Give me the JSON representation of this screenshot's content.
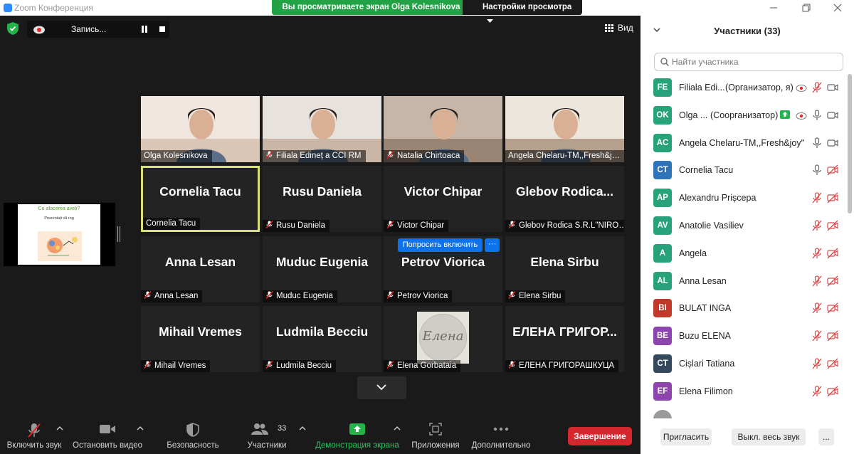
{
  "window": {
    "app_title": "Zoom Конференция"
  },
  "banner": {
    "text": "Вы просматриваете экран Olga Kolesnikova",
    "options_label": "Настройки просмотра"
  },
  "recording": {
    "label": "Запись..."
  },
  "view": {
    "label": "Вид"
  },
  "shared_screen": {
    "slide_title": "Ce afacerea aveți?",
    "slide_subtitle": "Prezentați vă rog"
  },
  "grid": {
    "ask_unmute_label": "Попросить включить",
    "more_label": "···",
    "tiles": [
      {
        "label": "Olga Kolesnikova",
        "muted": false,
        "video": true
      },
      {
        "label": "Filiala Edineț a CCI RM",
        "muted": true,
        "video": true
      },
      {
        "label": "Natalia Chirtoaca",
        "muted": true,
        "video": true
      },
      {
        "label": "Angela Chelaru-TM,,Fresh&j…",
        "muted": false,
        "video": true
      },
      {
        "name": "Cornelia Tacu",
        "label": "Cornelia Tacu",
        "muted": false,
        "active": true
      },
      {
        "name": "Rusu Daniela",
        "label": "Rusu Daniela",
        "muted": true
      },
      {
        "name": "Victor Chipar",
        "label": "Victor Chipar",
        "muted": true
      },
      {
        "name": "Glebov Rodica...",
        "label": "Glebov Rodica S.R.L\"NIRO…",
        "muted": true
      },
      {
        "name": "Anna Lesan",
        "label": "Anna Lesan",
        "muted": true
      },
      {
        "name": "Muduc Eugenia",
        "label": "Muduc Eugenia",
        "muted": true
      },
      {
        "name": "Petrov Viorica",
        "label": "Petrov Viorica",
        "muted": true
      },
      {
        "name": "Elena Sirbu",
        "label": "Elena Sirbu",
        "muted": true
      },
      {
        "name": "Mihail Vremes",
        "label": "Mihail Vremes",
        "muted": true
      },
      {
        "name": "Ludmila Becciu",
        "label": "Ludmila Becciu",
        "muted": true
      },
      {
        "label": "Elena Gorbataia",
        "muted": true,
        "avatar": true
      },
      {
        "name": "ЕЛЕНА ГРИГОР...",
        "label": "ЕЛЕНА ГРИГОРАШКУЦА",
        "muted": true
      }
    ]
  },
  "toolbar": {
    "unmute": "Включить звук",
    "video": "Остановить видео",
    "security": "Безопасность",
    "participants": "Участники",
    "participants_count": "33",
    "share": "Демонстрация экрана",
    "apps": "Приложения",
    "more": "Дополнительно",
    "end": "Завершение"
  },
  "panel": {
    "title": "Участники (33)",
    "search_placeholder": "Найти участника",
    "participants": [
      {
        "initials": "FE",
        "name": "Filiala Edi...",
        "role": "(Организатор, я)",
        "color": "#27a27a"
      },
      {
        "initials": "OK",
        "name": "Olga ...",
        "role": "(Соорганизатор)",
        "color": "#27a27a"
      },
      {
        "initials": "AC",
        "name": "Angela Chelaru-TM,,Fresh&joy''",
        "color": "#27a27a"
      },
      {
        "initials": "CT",
        "name": "Cornelia Tacu",
        "color": "#2f73b8"
      },
      {
        "initials": "AP",
        "name": "Alexandru Prișcepa",
        "color": "#27a27a"
      },
      {
        "initials": "AV",
        "name": "Anatolie Vasiliev",
        "color": "#27a27a"
      },
      {
        "initials": "A",
        "name": "Angela",
        "color": "#27a27a"
      },
      {
        "initials": "AL",
        "name": "Anna Lesan",
        "color": "#27a27a"
      },
      {
        "initials": "BI",
        "name": "BULAT INGA",
        "color": "#c0392b"
      },
      {
        "initials": "BE",
        "name": "Buzu ELENA",
        "color": "#8e44ad"
      },
      {
        "initials": "CT",
        "name": "Cișlari Tatiana",
        "color": "#34495e"
      },
      {
        "initials": "EF",
        "name": "Elena Filimon",
        "color": "#8e44ad"
      }
    ],
    "invite": "Пригласить",
    "mute_all": "Выкл. весь звук",
    "more": "..."
  }
}
